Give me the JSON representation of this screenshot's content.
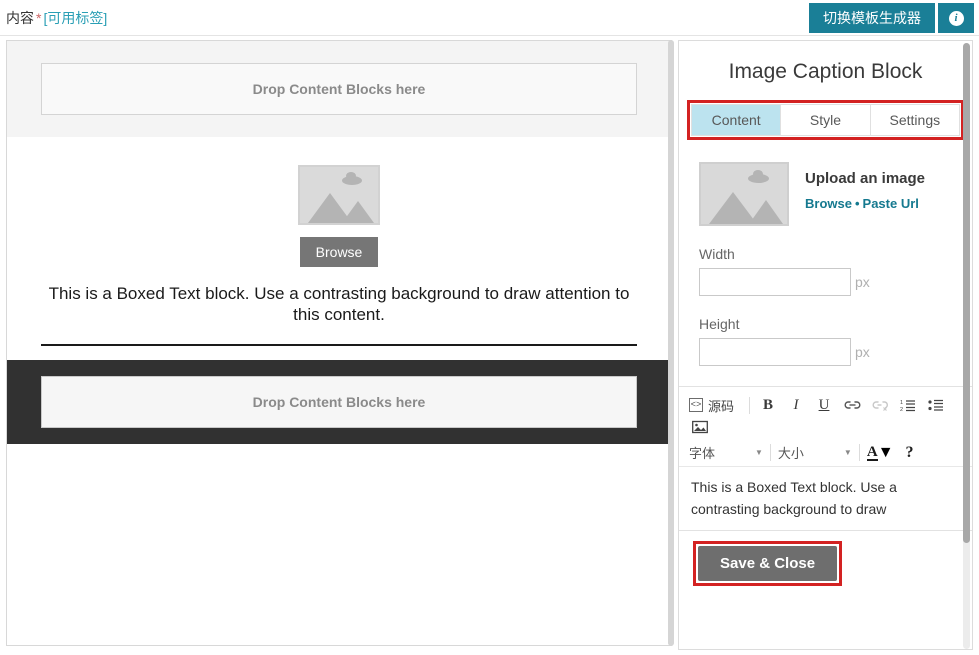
{
  "topbar": {
    "field_label": "内容",
    "required_mark": "*",
    "tags_link": "[可用标签]",
    "toggle_builder_label": "切换模板生成器",
    "info_glyph": "i",
    "accent_color": "#1a7f97"
  },
  "canvas": {
    "dropzone_top_text": "Drop Content Blocks here",
    "image_block": {
      "browse_label": "Browse"
    },
    "boxed_text": "This is a Boxed Text block. Use a contrasting background to draw attention to this content.",
    "dropzone_bottom_text": "Drop Content Blocks here",
    "dark_band_color": "#313131",
    "grey_band_color": "#f4f4f4"
  },
  "panel": {
    "title": "Image Caption Block",
    "highlight_color": "#d32222",
    "active_tab_color": "#bce3ef",
    "tabs": [
      {
        "label": "Content",
        "active": true
      },
      {
        "label": "Style",
        "active": false
      },
      {
        "label": "Settings",
        "active": false
      }
    ],
    "upload": {
      "heading": "Upload an image",
      "browse_label": "Browse",
      "separator": "•",
      "paste_url_label": "Paste Url",
      "link_color": "#15798f"
    },
    "fields": [
      {
        "label": "Width",
        "value": "",
        "unit": "px"
      },
      {
        "label": "Height",
        "value": "",
        "unit": "px"
      }
    ],
    "editor": {
      "toolbar": {
        "source_label": "源码",
        "bold_label": "B",
        "italic_label": "I",
        "underline_label": "U",
        "font_label": "字体",
        "size_label": "大小",
        "text_color_label": "A",
        "help_label": "?"
      },
      "content": "This is a Boxed Text block. Use a contrasting background to draw"
    },
    "save_label": "Save & Close"
  }
}
